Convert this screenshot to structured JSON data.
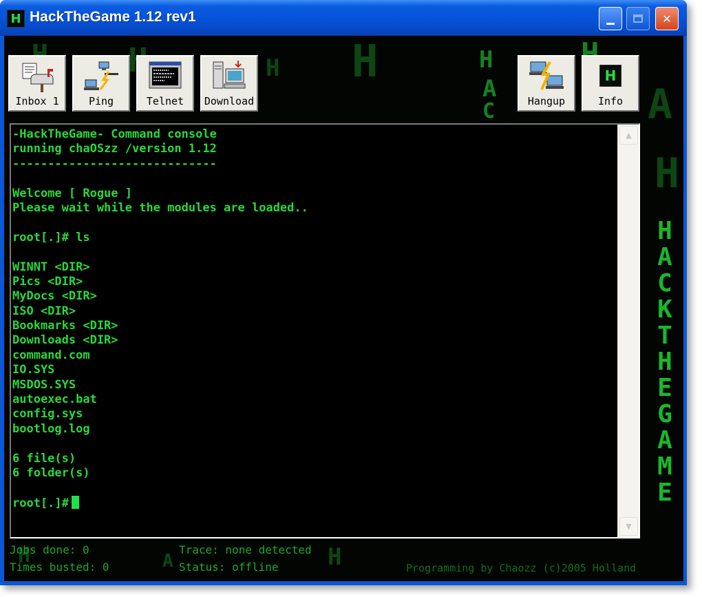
{
  "window": {
    "title": "HackTheGame 1.12 rev1",
    "app_icon_letter": "H"
  },
  "toolbar": {
    "inbox_label": "Inbox 1",
    "ping_label": "Ping",
    "telnet_label": "Telnet",
    "download_label": "Download",
    "hangup_label": "Hangup",
    "info_label": "Info",
    "info_icon_letter": "H"
  },
  "console": {
    "lines": [
      "-HackTheGame- Command console",
      "running chaOSzz /version 1.12",
      "-----------------------------",
      "",
      "Welcome [ Rogue ]",
      "Please wait while the modules are loaded..",
      "",
      "root[.]# ls",
      "",
      "WINNT <DIR>",
      "Pics <DIR>",
      "MyDocs <DIR>",
      "ISO <DIR>",
      "Bookmarks <DIR>",
      "Downloads <DIR>",
      "command.com",
      "IO.SYS",
      "MSDOS.SYS",
      "autoexec.bat",
      "config.sys",
      "bootlog.log",
      "",
      "6 file(s)",
      "6 folder(s)",
      ""
    ],
    "prompt": "root[.]#"
  },
  "status": {
    "jobs_done": "Jobs done: 0",
    "times_busted": "Times busted: 0",
    "trace": "Trace: none detected",
    "status": "Status: offline",
    "credit": "Programming by Chaozz (c)2005 Holland"
  },
  "branding": {
    "vertical_title": "HACKTHEGAME"
  },
  "colors": {
    "title_bar": "#0552d8",
    "console_text": "#28d93a",
    "background": "#020502"
  }
}
